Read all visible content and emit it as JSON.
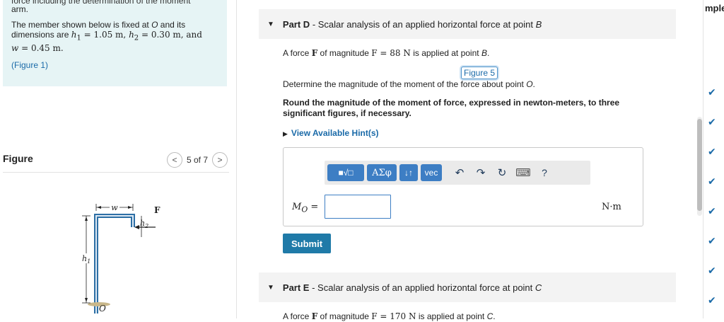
{
  "problem": {
    "cut_line": "force including the determination of the moment",
    "cut_line2": "arm.",
    "intro_a": "The member shown below is fixed at ",
    "intro_o": "O",
    "intro_b": " and its",
    "intro_c": "dimensions are ",
    "h1": "h",
    "h1_sub": "1",
    "h1_val": " = 1.05 m, ",
    "h2": "h",
    "h2_sub": "2",
    "h2_val": " = 0.30 m, and",
    "w": "w",
    "w_val": " = 0.45 m.",
    "figure_link": "(Figure 1)"
  },
  "figure_panel": {
    "title": "Figure",
    "pager_text": "5 of 7",
    "prev_icon": "<",
    "next_icon": ">"
  },
  "diagram_labels": {
    "w": "w",
    "F": "F",
    "h1": "h",
    "h1_sub": "1",
    "h2": "h",
    "h2_sub": "2",
    "O": "O"
  },
  "part_d": {
    "label": "Part D",
    "title": " - Scalar analysis of an applied horizontal force at point ",
    "point": "B",
    "line1_a": "A force ",
    "line1_F": "F",
    "line1_b": " of magnitude ",
    "line1_math": "F = 88 N",
    "line1_c": " is applied at point ",
    "line1_point": "B",
    "line1_end": ".",
    "figure_link": "Figure 5",
    "line2_a": "Determine the magnitude of the moment of the force about point ",
    "line2_point": "O",
    "line2_end": ".",
    "round_instr": "Round the magnitude of the moment of force, expressed in newton-meters, to three significant figures, if necessary.",
    "hint": "View Available Hint(s)"
  },
  "toolbar": {
    "templates_label": "■√□",
    "greek_label": "ΑΣφ",
    "updown_label": "↓↑",
    "vec_label": "vec",
    "undo_icon": "↶",
    "redo_icon": "↷",
    "reset_icon": "↻",
    "keyboard_icon": "⌨",
    "help_label": "?"
  },
  "answer": {
    "label_M": "M",
    "label_sub": "O",
    "label_eq": " =",
    "value": "",
    "unit": "N·m"
  },
  "submit_label": "Submit",
  "part_e": {
    "label": "Part E",
    "title": " - Scalar analysis of an applied horizontal force at point ",
    "point": "C",
    "line1_a": "A force ",
    "line1_F": "F",
    "line1_b": " of magnitude ",
    "line1_math": "F = 170 N",
    "line1_c": " is applied at point ",
    "line1_point": "C",
    "line1_end": "."
  },
  "right_panel": {
    "heading_fragment": "mple",
    "check_icon": "✔"
  },
  "colors": {
    "accent": "#3d7ec4",
    "link": "#1a6aa8",
    "problem_bg": "#e6f4f5",
    "submit_bg": "#1f7aa8"
  }
}
